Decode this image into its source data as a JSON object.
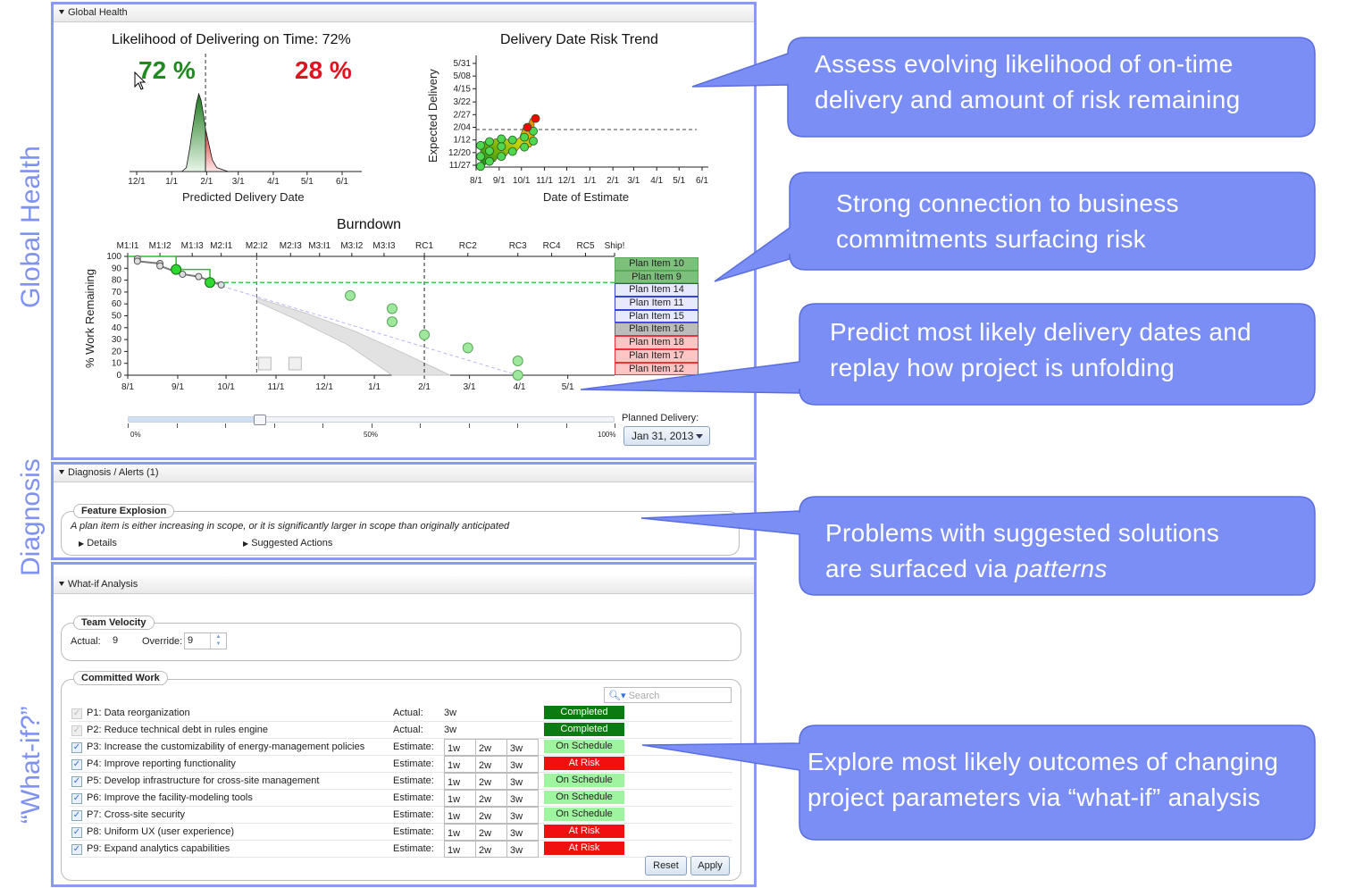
{
  "side_labels": {
    "global_health": "Global Health",
    "diagnosis": "Diagnosis",
    "what_if": "“What-if?”"
  },
  "colors": {
    "accent": "#7b8ef5",
    "on_time": "#1f8a1f",
    "risk": "#e0141e",
    "completed": "#0b7a10",
    "on_schedule": "#9ff59f",
    "at_risk": "#f01010"
  },
  "global_health": {
    "header": "Global Health",
    "likelihood": {
      "title": "Likelihood of Delivering on Time: 72%",
      "on_time_pct": "72 %",
      "late_pct": "28 %",
      "xlabel": "Predicted Delivery Date",
      "ticks": [
        "12/1",
        "1/1",
        "2/1",
        "3/1",
        "4/1",
        "5/1",
        "6/1"
      ],
      "tick_dates": [
        "2012-12-01",
        "2013-01-01",
        "2013-02-01",
        "2013-03-01",
        "2013-04-01",
        "2013-05-01",
        "2013-06-01"
      ],
      "cutoff": "2013-01-31",
      "density": [
        [
          "2013-01-10",
          0
        ],
        [
          "2013-01-14",
          0.05
        ],
        [
          "2013-01-17",
          0.3
        ],
        [
          "2013-01-20",
          0.6
        ],
        [
          "2013-01-23",
          0.88
        ],
        [
          "2013-01-25",
          1.0
        ],
        [
          "2013-01-27",
          0.92
        ],
        [
          "2013-01-29",
          0.75
        ],
        [
          "2013-01-31",
          0.55
        ],
        [
          "2013-02-03",
          0.35
        ],
        [
          "2013-02-06",
          0.15
        ],
        [
          "2013-02-10",
          0.05
        ],
        [
          "2013-02-16",
          0.02
        ],
        [
          "2013-02-20",
          0
        ]
      ]
    },
    "risk_trend": {
      "title": "Delivery Date Risk Trend",
      "xlabel": "Date of Estimate",
      "ylabel": "Expected Delivery",
      "xticks": [
        "8/1",
        "9/1",
        "10/1",
        "11/1",
        "12/1",
        "1/1",
        "2/1",
        "3/1",
        "4/1",
        "5/1",
        "6/1"
      ],
      "xtick_dates": [
        "2012-08-01",
        "2012-09-01",
        "2012-10-01",
        "2012-11-01",
        "2012-12-01",
        "2013-01-01",
        "2013-02-01",
        "2013-03-01",
        "2013-04-01",
        "2013-05-01",
        "2013-06-01"
      ],
      "yticks": [
        "5/31",
        "5/08",
        "4/15",
        "3/22",
        "2/27",
        "2/04",
        "1/12",
        "12/20",
        "11/27"
      ],
      "ytick_dates": [
        "2013-05-31",
        "2013-05-08",
        "2013-04-15",
        "2013-03-22",
        "2013-02-27",
        "2013-02-04",
        "2013-01-12",
        "2012-12-20",
        "2012-11-27"
      ],
      "planned": "2013-01-31",
      "points": [
        [
          "2012-08-07",
          "2012-11-25",
          "green"
        ],
        [
          "2012-08-07",
          "2012-12-13",
          "green"
        ],
        [
          "2012-08-07",
          "2013-01-02",
          "green"
        ],
        [
          "2012-08-19",
          "2012-12-04",
          "green"
        ],
        [
          "2012-08-19",
          "2012-12-23",
          "green"
        ],
        [
          "2012-08-19",
          "2013-01-09",
          "green"
        ],
        [
          "2012-09-04",
          "2012-12-13",
          "green"
        ],
        [
          "2012-09-04",
          "2012-12-31",
          "green"
        ],
        [
          "2012-09-04",
          "2013-01-14",
          "green"
        ],
        [
          "2012-09-19",
          "2012-12-22",
          "green"
        ],
        [
          "2012-09-19",
          "2013-01-12",
          "green"
        ],
        [
          "2012-10-05",
          "2012-12-30",
          "green"
        ],
        [
          "2012-10-05",
          "2013-01-17",
          "green"
        ],
        [
          "2012-10-17",
          "2013-01-10",
          "green"
        ],
        [
          "2012-10-17",
          "2013-01-28",
          "green"
        ],
        [
          "2012-10-09",
          "2013-02-04",
          "red"
        ],
        [
          "2012-10-20",
          "2013-02-20",
          "red"
        ]
      ]
    },
    "burndown": {
      "title": "Burndown",
      "ylabel": "% Work Remaining",
      "milestones": [
        "M1:I1",
        "M1:I2",
        "M1:I3",
        "M2:I1",
        "M2:I2",
        "M2:I3",
        "M3:I1",
        "M3:I2",
        "M3:I3",
        "RC1",
        "RC2",
        "RC3",
        "RC4",
        "RC5",
        "Ship!"
      ],
      "milestone_dates": [
        "2012-08-01",
        "2012-08-21",
        "2012-09-10",
        "2012-09-28",
        "2012-10-20",
        "2012-11-10",
        "2012-11-28",
        "2012-12-18",
        "2013-01-07",
        "2013-02-01",
        "2013-02-28",
        "2013-03-31",
        "2013-04-21",
        "2013-05-12",
        "2013-05-30"
      ],
      "xticks": [
        "8/1",
        "9/1",
        "10/1",
        "11/1",
        "12/1",
        "1/1",
        "2/1",
        "3/1",
        "4/1",
        "5/1"
      ],
      "xtick_dates": [
        "2012-08-01",
        "2012-09-01",
        "2012-10-01",
        "2012-11-01",
        "2012-12-01",
        "2013-01-01",
        "2013-02-01",
        "2013-03-01",
        "2013-04-01",
        "2013-05-01"
      ],
      "yticks": [
        100,
        90,
        80,
        70,
        60,
        50,
        40,
        30,
        20,
        10,
        0
      ],
      "x_end": "2013-05-30",
      "now": "2012-10-20",
      "planned": "2013-02-01",
      "target_level": 78,
      "actual": [
        [
          "2012-08-07",
          98
        ],
        [
          "2012-08-07",
          96
        ],
        [
          "2012-08-21",
          94
        ],
        [
          "2012-08-21",
          92
        ],
        [
          "2012-09-04",
          85
        ],
        [
          "2012-09-14",
          83
        ],
        [
          "2012-09-28",
          76
        ]
      ],
      "completed": [
        [
          "2012-08-31",
          89
        ],
        [
          "2012-09-21",
          78
        ]
      ],
      "step": [
        [
          "2012-08-01",
          100
        ],
        [
          "2012-08-31",
          100
        ],
        [
          "2012-08-31",
          89
        ],
        [
          "2012-09-21",
          89
        ],
        [
          "2012-09-21",
          78
        ]
      ],
      "forecast_upper": [
        [
          "2012-10-20",
          65
        ],
        [
          "2012-11-20",
          52
        ],
        [
          "2012-12-20",
          37
        ],
        [
          "2013-01-20",
          18
        ],
        [
          "2013-02-17",
          0
        ]
      ],
      "forecast_lower": [
        [
          "2012-10-20",
          62
        ],
        [
          "2012-11-15",
          46
        ],
        [
          "2012-12-15",
          26
        ],
        [
          "2013-01-12",
          0
        ]
      ],
      "trend": [
        [
          "2012-09-21",
          78
        ],
        [
          "2013-03-31",
          0
        ]
      ],
      "plan_points": [
        [
          "2012-12-17",
          67
        ],
        [
          "2013-01-12",
          56
        ],
        [
          "2013-01-12",
          45
        ],
        [
          "2013-02-01",
          34
        ],
        [
          "2013-02-28",
          23
        ],
        [
          "2013-03-31",
          12
        ],
        [
          "2013-03-31",
          0
        ]
      ],
      "plan_items": [
        {
          "label": "Plan Item 10",
          "state": "done"
        },
        {
          "label": "Plan Item 9",
          "state": "done"
        },
        {
          "label": "Plan Item 14",
          "state": "active"
        },
        {
          "label": "Plan Item 11",
          "state": "active"
        },
        {
          "label": "Plan Item 15",
          "state": "active"
        },
        {
          "label": "Plan Item 16",
          "state": "neutral"
        },
        {
          "label": "Plan Item 18",
          "state": "risk"
        },
        {
          "label": "Plan Item 17",
          "state": "risk"
        },
        {
          "label": "Plan Item 12",
          "state": "risk"
        }
      ]
    },
    "slider": {
      "value_pct": 27,
      "labels": [
        "0%",
        "50%",
        "100%"
      ]
    },
    "planned_delivery": {
      "label": "Planned Delivery:",
      "value": "Jan 31, 2013"
    }
  },
  "diagnosis": {
    "header": "Diagnosis / Alerts (1)",
    "alert_title": "Feature Explosion",
    "alert_text": "A plan item is either increasing in scope, or it is significantly larger in scope than originally anticipated",
    "details": "Details",
    "suggested": "Suggested Actions"
  },
  "what_if": {
    "header": "What-if Analysis",
    "velocity": {
      "legend": "Team Velocity",
      "actual_label": "Actual:",
      "actual": "9",
      "override_label": "Override:",
      "override": "9"
    },
    "committed": {
      "legend": "Committed Work",
      "search_placeholder": "Search",
      "estimate_options": [
        "1w",
        "2w",
        "3w"
      ],
      "rows": [
        {
          "name": "P1: Data reorganization",
          "kind": "Actual:",
          "value": "3w",
          "status": "Completed",
          "type": "completed",
          "checked": true,
          "disabled": true
        },
        {
          "name": "P2: Reduce technical debt in rules engine",
          "kind": "Actual:",
          "value": "3w",
          "status": "Completed",
          "type": "completed",
          "checked": true,
          "disabled": true
        },
        {
          "name": "P3: Increase the customizability of energy-management policies",
          "kind": "Estimate:",
          "status": "On Schedule",
          "type": "on_schedule",
          "checked": true
        },
        {
          "name": "P4: Improve reporting functionality",
          "kind": "Estimate:",
          "status": "At Risk",
          "type": "at_risk",
          "checked": true
        },
        {
          "name": "P5: Develop infrastructure for cross-site management",
          "kind": "Estimate:",
          "status": "On Schedule",
          "type": "on_schedule",
          "checked": true
        },
        {
          "name": "P6: Improve the facility-modeling tools",
          "kind": "Estimate:",
          "status": "On Schedule",
          "type": "on_schedule",
          "checked": true
        },
        {
          "name": "P7: Cross-site security",
          "kind": "Estimate:",
          "status": "On Schedule",
          "type": "on_schedule",
          "checked": true
        },
        {
          "name": "P8: Uniform UX (user experience)",
          "kind": "Estimate:",
          "status": "At Risk",
          "type": "at_risk",
          "checked": true
        },
        {
          "name": "P9: Expand analytics capabilities",
          "kind": "Estimate:",
          "status": "At Risk",
          "type": "at_risk",
          "checked": true
        }
      ]
    },
    "reset": "Reset",
    "apply": "Apply"
  },
  "callouts": [
    {
      "lines": [
        "Assess evolving likelihood of on-time",
        "delivery and amount of risk remaining"
      ]
    },
    {
      "lines": [
        "Strong connection to business",
        "commitments surfacing  risk"
      ]
    },
    {
      "lines": [
        "Predict most likely delivery dates and",
        "replay how project is unfolding"
      ]
    },
    {
      "lines": [
        "Problems with suggested solutions",
        "are surfaced via "
      ],
      "emphasis": "patterns"
    },
    {
      "lines": [
        "Explore most likely outcomes of changing",
        "project parameters via “what-if” analysis"
      ]
    }
  ]
}
